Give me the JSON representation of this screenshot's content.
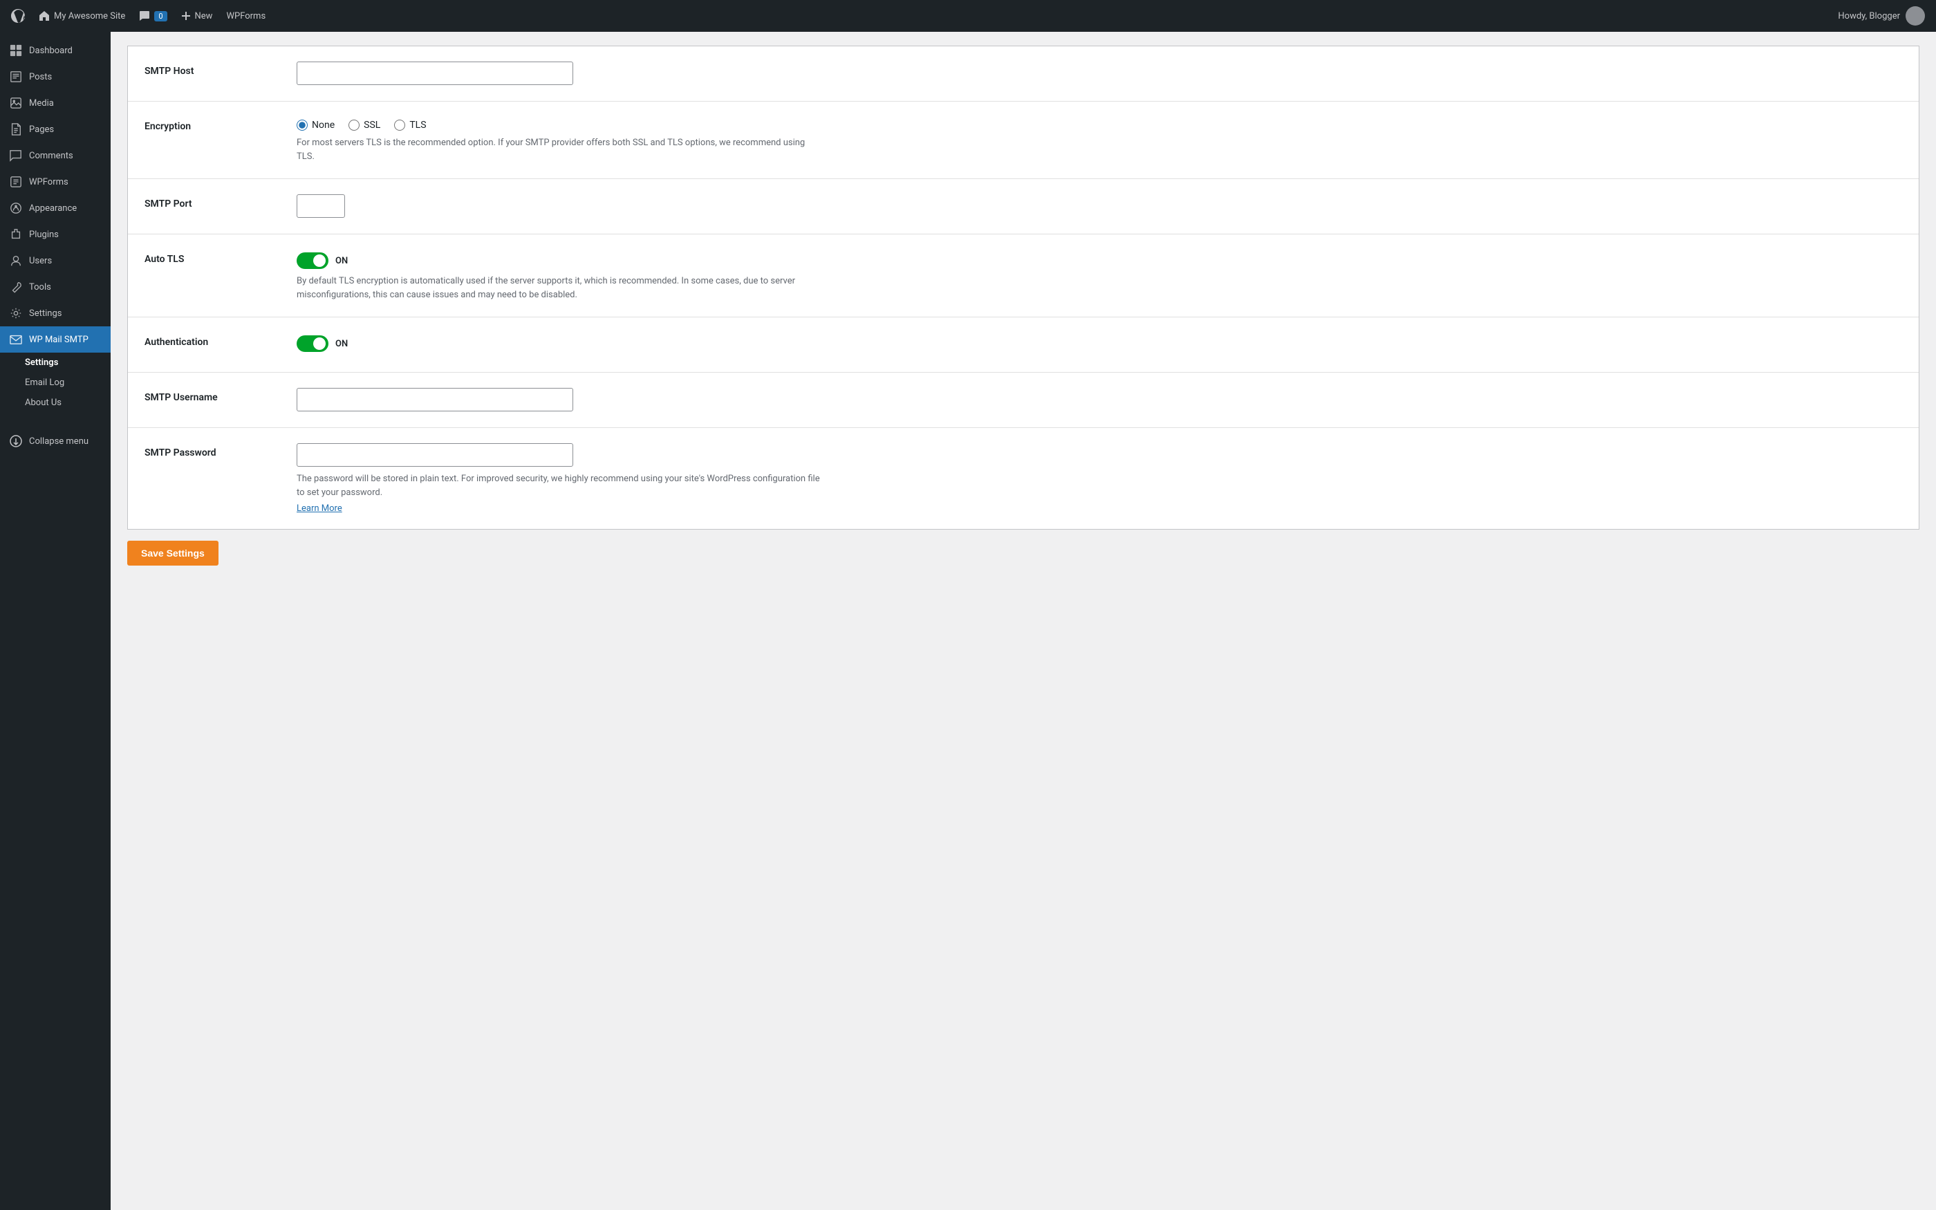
{
  "adminBar": {
    "siteName": "My Awesome Site",
    "newLabel": "New",
    "wpFormsLabel": "WPForms",
    "commentCount": "0",
    "howdy": "Howdy, Blogger"
  },
  "sidebar": {
    "items": [
      {
        "id": "dashboard",
        "label": "Dashboard"
      },
      {
        "id": "posts",
        "label": "Posts"
      },
      {
        "id": "media",
        "label": "Media"
      },
      {
        "id": "pages",
        "label": "Pages"
      },
      {
        "id": "comments",
        "label": "Comments"
      },
      {
        "id": "wpforms",
        "label": "WPForms"
      },
      {
        "id": "appearance",
        "label": "Appearance"
      },
      {
        "id": "plugins",
        "label": "Plugins"
      },
      {
        "id": "users",
        "label": "Users"
      },
      {
        "id": "tools",
        "label": "Tools"
      },
      {
        "id": "settings",
        "label": "Settings"
      },
      {
        "id": "wp-mail-smtp",
        "label": "WP Mail SMTP"
      }
    ],
    "subItems": [
      {
        "id": "settings-sub",
        "label": "Settings"
      },
      {
        "id": "email-log",
        "label": "Email Log"
      },
      {
        "id": "about-us",
        "label": "About Us"
      }
    ],
    "collapseLabel": "Collapse menu"
  },
  "form": {
    "smtpHostLabel": "SMTP Host",
    "smtpHostValue": "",
    "smtpHostPlaceholder": "",
    "encryptionLabel": "Encryption",
    "encryptionOptions": [
      "None",
      "SSL",
      "TLS"
    ],
    "encryptionSelected": "None",
    "encryptionHelp": "For most servers TLS is the recommended option. If your SMTP provider offers both SSL and TLS options, we recommend using TLS.",
    "smtpPortLabel": "SMTP Port",
    "smtpPortValue": "",
    "autoTLSLabel": "Auto TLS",
    "autoTLSOn": "ON",
    "autoTLSHelp": "By default TLS encryption is automatically used if the server supports it, which is recommended. In some cases, due to server misconfigurations, this can cause issues and may need to be disabled.",
    "authenticationLabel": "Authentication",
    "authenticationOn": "ON",
    "smtpUsernameLabel": "SMTP Username",
    "smtpUsernameValue": "",
    "smtpPasswordLabel": "SMTP Password",
    "smtpPasswordValue": "",
    "passwordHelp": "The password will be stored in plain text. For improved security, we highly recommend using your site's WordPress configuration file to set your password.",
    "learnMoreLabel": "Learn More",
    "saveButtonLabel": "Save Settings"
  }
}
